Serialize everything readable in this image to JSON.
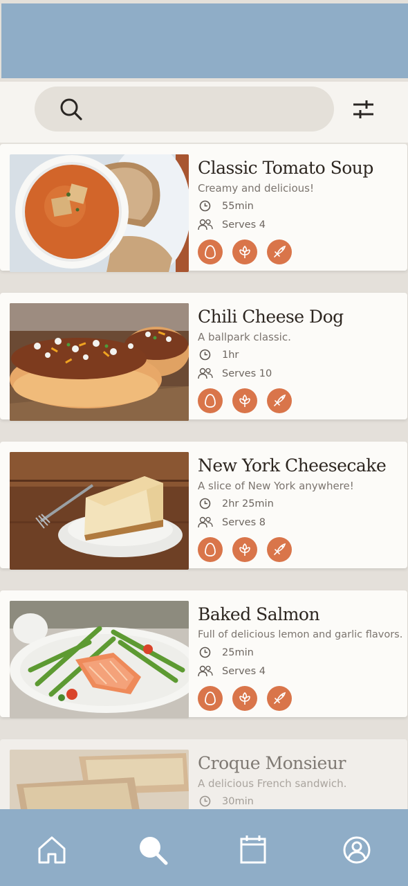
{
  "search": {
    "placeholder": "",
    "icon": "search-icon",
    "filter_icon": "filter-sliders-icon"
  },
  "recipes": [
    {
      "title": "Classic Tomato Soup",
      "subtitle": "Creamy and delicious!",
      "time": "55min",
      "serves": "Serves 4",
      "badges": [
        "egg-icon",
        "grain-icon",
        "fish-icon"
      ]
    },
    {
      "title": "Chili Cheese Dog",
      "subtitle": "A ballpark classic.",
      "time": "1hr",
      "serves": "Serves 10",
      "badges": [
        "egg-icon",
        "grain-icon",
        "fish-icon"
      ]
    },
    {
      "title": "New York Cheesecake",
      "subtitle": "A slice of New York anywhere!",
      "time": "2hr 25min",
      "serves": "Serves 8",
      "badges": [
        "egg-icon",
        "grain-icon",
        "fish-icon"
      ]
    },
    {
      "title": "Baked Salmon",
      "subtitle": "Full of delicious lemon and garlic flavors.",
      "time": "25min",
      "serves": "Serves 4",
      "badges": [
        "egg-icon",
        "grain-icon",
        "fish-icon"
      ]
    },
    {
      "title": "Croque Monsieur",
      "subtitle": "A delicious French sandwich.",
      "time": "30min",
      "serves": "",
      "badges": []
    }
  ],
  "nav": [
    "home-icon",
    "search-icon",
    "calendar-icon",
    "profile-icon"
  ],
  "colors": {
    "header": "#8fadc7",
    "accent": "#d9754a",
    "background": "#e4e0da",
    "card": "#fcfbf8"
  }
}
